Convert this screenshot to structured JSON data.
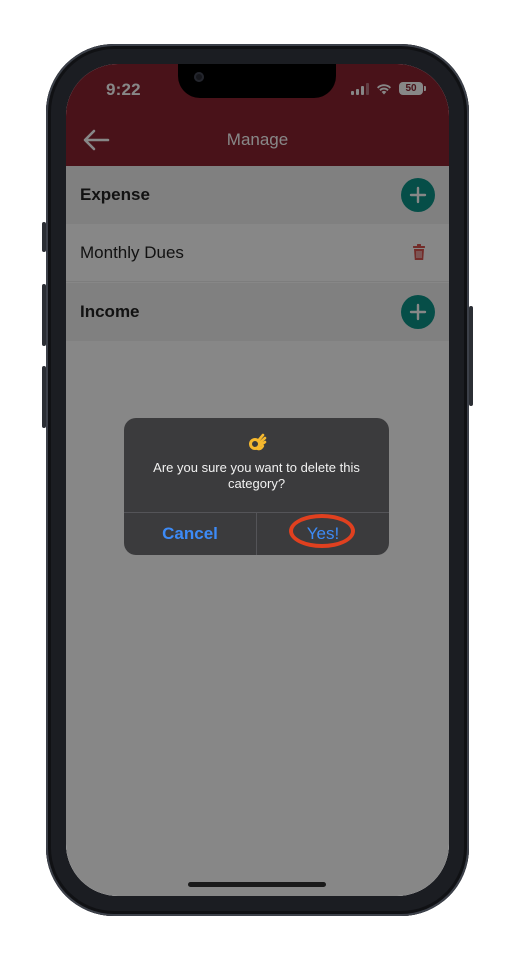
{
  "status_bar": {
    "time": "9:22",
    "battery": "50"
  },
  "appbar": {
    "title": "Manage",
    "back_icon": "arrow-left-icon",
    "color": "#8b2230"
  },
  "sections": [
    {
      "label": "Expense",
      "add_icon": "plus-icon"
    },
    {
      "label": "Income",
      "add_icon": "plus-icon"
    }
  ],
  "expense_items": [
    {
      "label": "Monthly Dues",
      "delete_icon": "trash-icon"
    }
  ],
  "dialog": {
    "emoji": "👌",
    "message": "Are you sure you want to delete this category?",
    "cancel_label": "Cancel",
    "confirm_label": "Yes!"
  },
  "colors": {
    "accent_teal": "#0d9488",
    "delete_red": "#d9534f",
    "dialog_button_blue": "#3d8bf7",
    "highlight_ring": "#e0401f"
  }
}
